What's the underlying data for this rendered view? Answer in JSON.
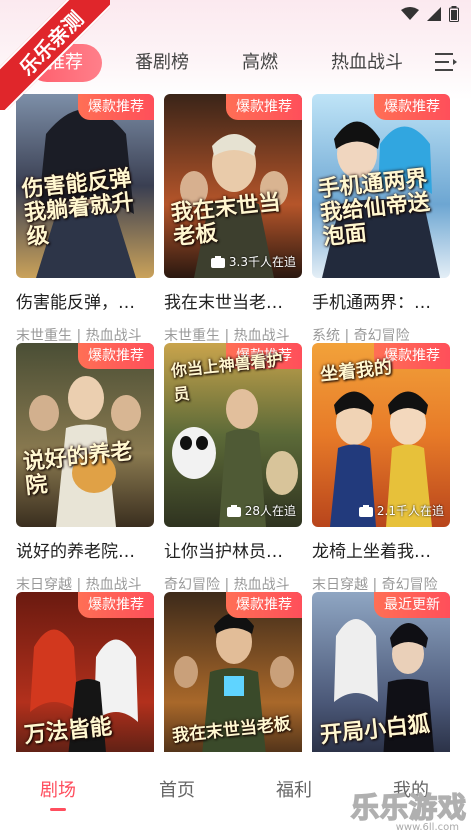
{
  "watermark_ribbon": "乐乐亲测",
  "tabs": [
    {
      "label": "推荐",
      "active": true
    },
    {
      "label": "番剧榜",
      "active": false
    },
    {
      "label": "高燃",
      "active": false
    },
    {
      "label": "热血战斗",
      "active": false
    }
  ],
  "cards": [
    {
      "badge": "爆款推荐",
      "cover_text": "伤害能反弹 我躺着就升级",
      "followers": "",
      "title": "伤害能反弹，…",
      "tags": "末世重生 | 热血战斗"
    },
    {
      "badge": "爆款推荐",
      "cover_text": "我在末世当老板",
      "followers": "3.3千人在追",
      "title": "我在末世当老…",
      "tags": "末世重生 | 热血战斗"
    },
    {
      "badge": "爆款推荐",
      "cover_text": "手机通两界 我给仙帝送泡面",
      "followers": "",
      "title": "手机通两界：…",
      "tags": "系统 | 奇幻冒险"
    },
    {
      "badge": "爆款推荐",
      "cover_text": "说好的养老院",
      "followers": "",
      "title": "说好的养老院…",
      "tags": "末日穿越 | 热血战斗"
    },
    {
      "badge": "爆款推荐",
      "cover_text": "你当上神兽看护员",
      "followers": "28人在追",
      "title": "让你当护林员…",
      "tags": "奇幻冒险 | 热血战斗"
    },
    {
      "badge": "爆款推荐",
      "cover_text": "坐着我的",
      "followers": "2.1千人在追",
      "title": "龙椅上坐着我…",
      "tags": "末日穿越 | 奇幻冒险"
    },
    {
      "badge": "爆款推荐",
      "cover_text": "万法皆能",
      "followers": "",
      "title": "",
      "tags": ""
    },
    {
      "badge": "爆款推荐",
      "cover_text": "我在末世当老板",
      "followers": "",
      "title": "",
      "tags": ""
    },
    {
      "badge": "最近更新",
      "cover_text": "开局小白狐",
      "followers": "",
      "title": "",
      "tags": ""
    }
  ],
  "bottom_nav": [
    {
      "label": "剧场",
      "active": true
    },
    {
      "label": "首页",
      "active": false
    },
    {
      "label": "福利",
      "active": false
    },
    {
      "label": "我的",
      "active": false
    }
  ],
  "watermark": {
    "text": "乐乐游戏",
    "url": "www.6ll.com"
  },
  "colors": {
    "accent": "#ff4e5e",
    "badge": "#ff5a5a",
    "ribbon": "#e0262b"
  }
}
